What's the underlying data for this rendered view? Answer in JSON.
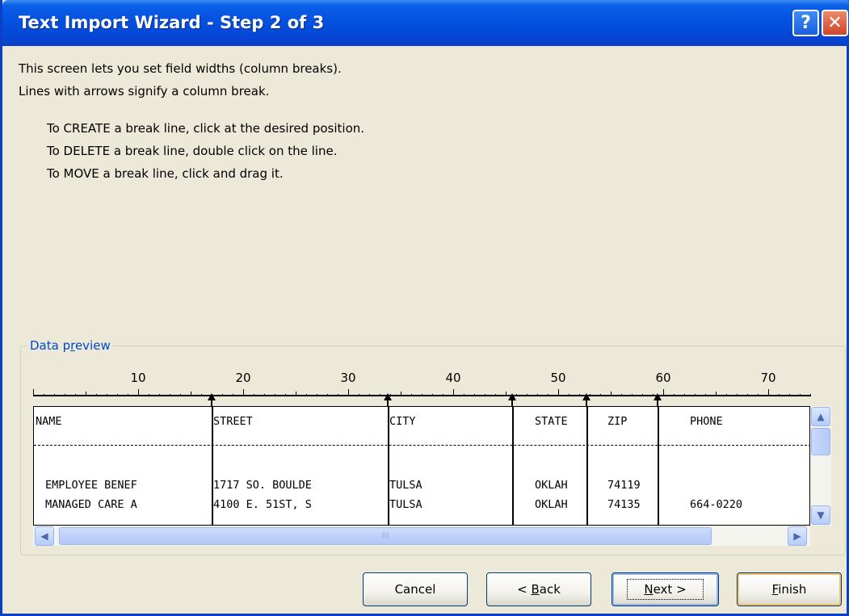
{
  "window": {
    "title": "Text Import Wizard - Step 2 of 3",
    "help_label": "?",
    "close_label": "✕"
  },
  "instructions": {
    "line1": "This screen lets you set field widths (column breaks).",
    "line2": "Lines with arrows signify a column break.",
    "create": "To CREATE a break line, click at the desired position.",
    "delete": "To DELETE a break line, double click on the line.",
    "move": "To MOVE a break line, click and drag it."
  },
  "preview": {
    "group_label_accel": "Data p",
    "group_label_u": "r",
    "group_label_rest": "eview",
    "ruler_numbers": [
      "10",
      "20",
      "30",
      "40",
      "50",
      "60",
      "70"
    ],
    "headers": [
      "NAME",
      "STREET",
      "CITY",
      "STATE",
      "ZIP",
      "PHONE"
    ],
    "rows": [
      [
        "EMPLOYEE BENEF",
        "1717 SO. BOULDE",
        "TULSA",
        "OKLAH",
        "74119",
        ""
      ],
      [
        "MANAGED CARE A",
        "4100 E. 51ST, S",
        "TULSA",
        "OKLAH",
        "74135",
        "664-0220"
      ]
    ],
    "hscroll_grip": "III"
  },
  "buttons": {
    "cancel": "Cancel",
    "back_pre": "< ",
    "back_accel": "B",
    "back_rest": "ack",
    "next_accel": "N",
    "next_rest": "ext >",
    "finish_accel": "F",
    "finish_rest": "inish"
  }
}
